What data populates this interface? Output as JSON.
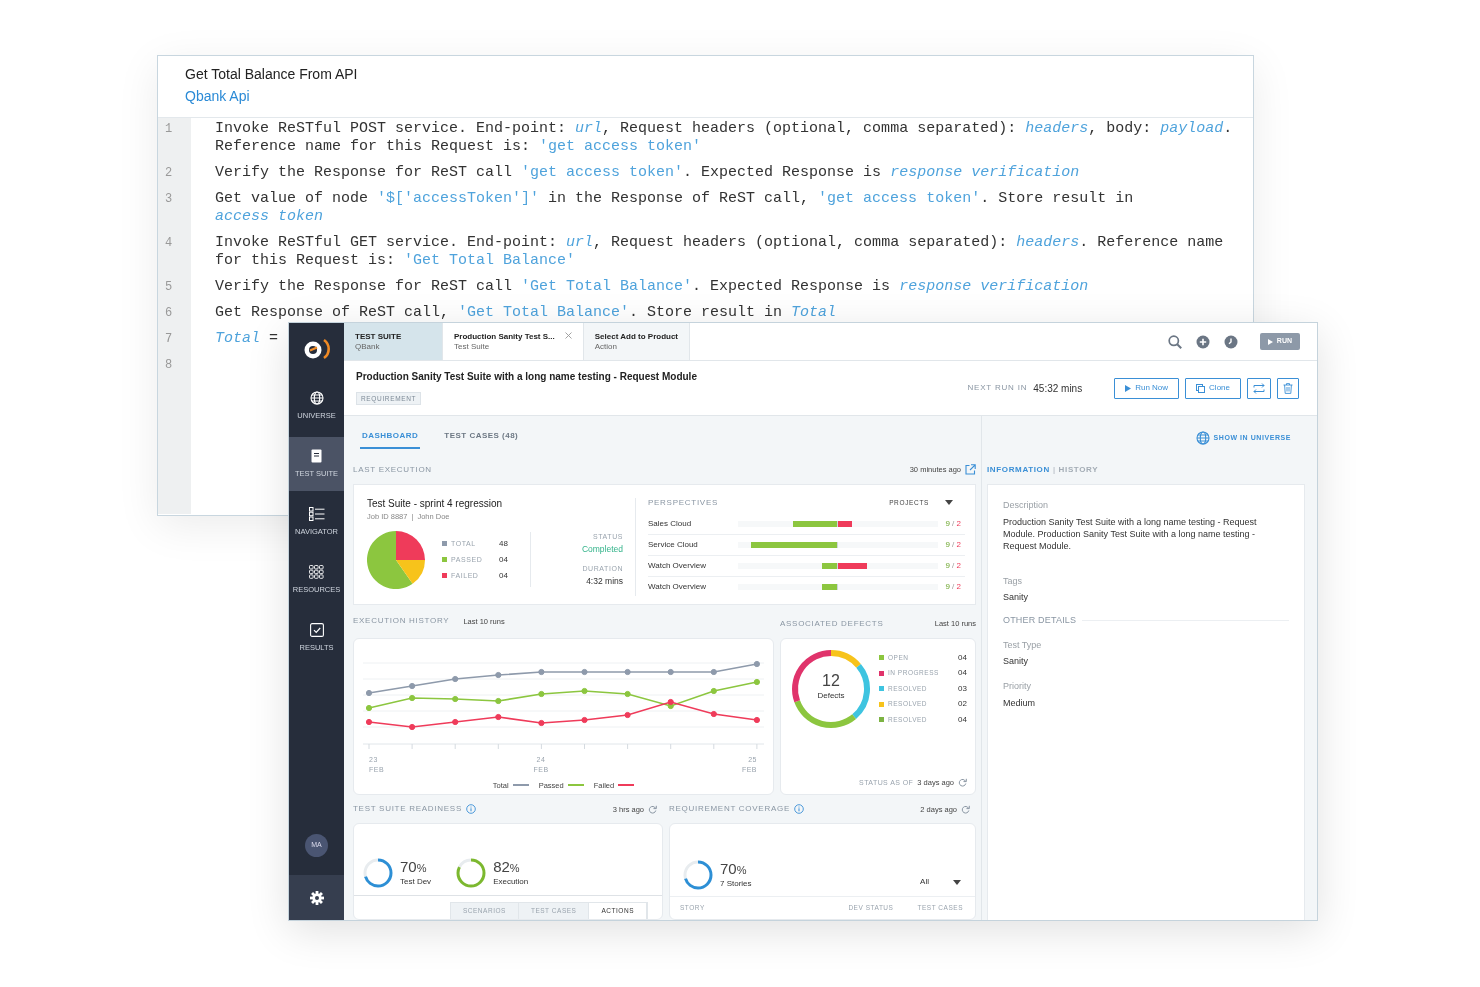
{
  "editor": {
    "title": "Get Total Balance From API",
    "subtitle": "Qbank Api",
    "lines": [
      {
        "number": "1",
        "segments": [
          {
            "kind": "text",
            "text": "Invoke ReSTful POST service. End-point: "
          },
          {
            "kind": "var",
            "text": "url"
          },
          {
            "kind": "text",
            "text": ", Request headers (optional, comma separated): "
          },
          {
            "kind": "var",
            "text": "headers"
          },
          {
            "kind": "text",
            "text": ", body: "
          },
          {
            "kind": "var",
            "text": "payload"
          },
          {
            "kind": "text",
            "text": ". Reference name for this Request is: "
          },
          {
            "kind": "string",
            "text": "'get access token'"
          }
        ]
      },
      {
        "number": "2",
        "segments": [
          {
            "kind": "text",
            "text": "Verify the Response for ReST call "
          },
          {
            "kind": "string",
            "text": "'get access token'"
          },
          {
            "kind": "text",
            "text": ". Expected Response is "
          },
          {
            "kind": "var",
            "text": "response verification"
          }
        ]
      },
      {
        "number": "3",
        "segments": [
          {
            "kind": "text",
            "text": "Get value of node "
          },
          {
            "kind": "string",
            "text": "'$['accessToken']'"
          },
          {
            "kind": "text",
            "text": " in the Response of ReST call, "
          },
          {
            "kind": "string",
            "text": "'get access token'"
          },
          {
            "kind": "text",
            "text": ". Store result in "
          },
          {
            "kind": "var",
            "text": "access token"
          }
        ]
      },
      {
        "number": "4",
        "segments": [
          {
            "kind": "text",
            "text": "Invoke ReSTful GET service. End-point: "
          },
          {
            "kind": "var",
            "text": "url"
          },
          {
            "kind": "text",
            "text": ", Request headers (optional, comma separated): "
          },
          {
            "kind": "var",
            "text": "headers"
          },
          {
            "kind": "text",
            "text": ". Reference name for this Request is: "
          },
          {
            "kind": "string",
            "text": "'Get Total Balance'"
          }
        ]
      },
      {
        "number": "5",
        "segments": [
          {
            "kind": "text",
            "text": "Verify the Response for ReST call "
          },
          {
            "kind": "string",
            "text": "'Get Total Balance'"
          },
          {
            "kind": "text",
            "text": ". Expected Response is "
          },
          {
            "kind": "var",
            "text": "response verification"
          }
        ]
      },
      {
        "number": "6",
        "segments": [
          {
            "kind": "text",
            "text": "Get Response of ReST call, "
          },
          {
            "kind": "string",
            "text": "'Get Total Balance'"
          },
          {
            "kind": "text",
            "text": ". Store result in "
          },
          {
            "kind": "var",
            "text": "Total"
          }
        ]
      },
      {
        "number": "7",
        "segments": [
          {
            "kind": "var",
            "text": "Total"
          },
          {
            "kind": "text",
            "text": " ="
          }
        ]
      },
      {
        "number": "8"
      }
    ]
  },
  "app": {
    "sidebar": {
      "items": [
        {
          "label": "UNIVERSE",
          "kind": "globe",
          "selected": false
        },
        {
          "label": "TEST SUITE",
          "kind": "document",
          "selected": true
        },
        {
          "label": "NAVIGATOR",
          "kind": "list",
          "selected": false
        },
        {
          "label": "RESOURCES",
          "kind": "grid",
          "selected": false
        },
        {
          "label": "RESULTS",
          "kind": "check",
          "selected": false
        }
      ],
      "avatar": "MA"
    },
    "tabs": [
      {
        "title": "TEST SUITE",
        "subtitle": "QBank",
        "kind": "root",
        "selected": false,
        "closable": false
      },
      {
        "title": "Production Sanity Test S...",
        "subtitle": "Test Suite",
        "kind": "item",
        "selected": true,
        "closable": true
      },
      {
        "title": "Select Add to Product",
        "subtitle": "Action",
        "kind": "item",
        "selected": false,
        "closable": false
      }
    ],
    "run_button": "RUN",
    "header": {
      "title": "Production Sanity Test Suite with a long name testing - Request Module",
      "badge": "REQUIREMENT",
      "next_run_label": "NEXT RUN IN",
      "next_run_value": "45:32 mins",
      "buttons": [
        {
          "kind": "play",
          "label": "Run Now"
        },
        {
          "kind": "copy",
          "label": "Clone"
        },
        {
          "kind": "swap"
        },
        {
          "kind": "delete"
        }
      ]
    },
    "view_tabs": [
      {
        "label": "DASHBOARD",
        "selected": true
      },
      {
        "label": "TEST CASES (48)",
        "selected": false
      }
    ],
    "show_in_universe": "SHOW IN UNIVERSE",
    "last_execution": {
      "heading": "LAST EXECUTION",
      "time": "30 minutes ago",
      "suite": "Test Suite - sprint 4 regression",
      "job": "Job ID 8887",
      "job_separator": "|",
      "user": "John Doe",
      "stats": [
        {
          "label": "TOTAL",
          "value": "48",
          "color": "#8e9aab"
        },
        {
          "label": "PASSED",
          "value": "04",
          "color": "#8cc63f"
        },
        {
          "label": "FAILED",
          "value": "04",
          "color": "#ef3b5a"
        }
      ],
      "status_label": "STATUS",
      "status": "Completed",
      "duration_label": "DURATION",
      "duration": "4:32 mins",
      "perspectives": {
        "heading": "PERSPECTIVES",
        "filter": "PROJECTS",
        "ratio_separator": "/",
        "rows": [
          {
            "name": "Sales Cloud",
            "passed": "9",
            "failed": "2",
            "passed_bar": {
              "level": 0.44
            },
            "failed_bar": {
              "level": 0.14
            }
          },
          {
            "name": "Service Cloud",
            "passed": "9",
            "failed": "2",
            "passed_bar": {
              "level": 0.87
            }
          },
          {
            "name": "Watch Overview",
            "passed": "9",
            "failed": "2",
            "passed_bar": {
              "level": 0.15
            },
            "failed_bar": {
              "level": 0.29
            }
          },
          {
            "name": "Watch Overview",
            "passed": "9",
            "failed": "2",
            "passed_bar": {
              "level": 0.15
            }
          }
        ]
      }
    },
    "execution_history": {
      "heading": "EXECUTION HISTORY",
      "range": "Last 10 runs",
      "x_labels": [
        {
          "day": "23",
          "month": "FEB"
        },
        {
          "day": "24",
          "month": "FEB"
        },
        {
          "day": "25",
          "month": "FEB"
        }
      ],
      "legend": [
        {
          "label": "Total",
          "color": "#8e9aab"
        },
        {
          "label": "Passed",
          "color": "#8cc63f"
        },
        {
          "label": "Failed",
          "color": "#ef3b5a"
        }
      ]
    },
    "defects": {
      "heading": "ASSOCIATED DEFECTS",
      "range": "Last 10 runs",
      "total": "12",
      "total_label": "Defects",
      "items": [
        {
          "label": "OPEN",
          "count": "04",
          "color": "#8cc63f"
        },
        {
          "label": "IN PROGRESS",
          "count": "04",
          "color": "#e0336b"
        },
        {
          "label": "RESOLVED",
          "count": "03",
          "color": "#3ec4e0"
        },
        {
          "label": "RESOLVED",
          "count": "02",
          "color": "#f7c31b"
        },
        {
          "label": "RESOLVED",
          "count": "04",
          "color": "#7cb342"
        }
      ],
      "status_label": "STATUS AS OF",
      "status_time": "3 days ago"
    },
    "readiness": {
      "heading": "TEST SUITE READINESS",
      "time": "3  hrs ago",
      "rings": [
        {
          "value": "70",
          "unit": "%",
          "label": "Test Dev",
          "level": 0.7,
          "color": "#2d8fd5"
        },
        {
          "value": "82",
          "unit": "%",
          "label": "Execution",
          "level": 0.82,
          "color": "#7cb82f"
        }
      ],
      "segments": [
        {
          "label": "SCENARIOS",
          "selected": false
        },
        {
          "label": "TEST CASES",
          "selected": false
        },
        {
          "label": "ACTIONS",
          "selected": true
        }
      ]
    },
    "coverage": {
      "heading": "REQUIREMENT COVERAGE",
      "time": "2 days ago",
      "ring": {
        "value": "70",
        "unit": "%",
        "label": "7 Stories",
        "level": 0.7,
        "color": "#2d8fd5"
      },
      "filter": "All",
      "columns": [
        "STORY",
        "DEV STATUS",
        "TEST CASES"
      ]
    },
    "info": {
      "tabs": [
        {
          "label": "INFORMATION",
          "selected": true
        },
        {
          "label": "HISTORY",
          "selected": false
        }
      ],
      "tab_separator": "|",
      "fields": [
        {
          "label": "Description",
          "value": "Production Sanity Test Suite with a long name testing - Request Module. Production Sanity Test Suite with a long name testing - Request Module."
        },
        {
          "label": "Tags",
          "value": "Sanity"
        }
      ],
      "section": "OTHER DETAILS",
      "details": [
        {
          "label": "Test Type",
          "value": "Sanity"
        },
        {
          "label": "Priority",
          "value": "Medium"
        }
      ]
    }
  }
}
